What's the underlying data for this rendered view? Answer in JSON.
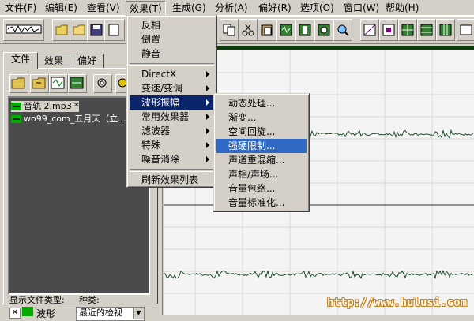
{
  "menubar": {
    "items": [
      {
        "label": "文件(F)"
      },
      {
        "label": "编辑(E)"
      },
      {
        "label": "查看(V)"
      },
      {
        "label": "效果(T)"
      },
      {
        "label": "生成(G)"
      },
      {
        "label": "分析(A)"
      },
      {
        "label": "偏好(R)"
      },
      {
        "label": "选项(O)"
      },
      {
        "label": "窗口(W)"
      },
      {
        "label": "帮助(H)"
      }
    ]
  },
  "left_panel": {
    "tabs": [
      {
        "label": "文件"
      },
      {
        "label": "效果"
      },
      {
        "label": "偏好"
      }
    ],
    "files": [
      {
        "name": "音轨  2.mp3 *"
      },
      {
        "name": "wo99_com_五月天（立..."
      }
    ],
    "file_type_label": "显示文件类型:",
    "kind_label": "种类:",
    "checkbox_label": "波形",
    "sort_value": "最近的检视"
  },
  "effects_menu": {
    "items": [
      {
        "label": "反相"
      },
      {
        "label": "倒置"
      },
      {
        "label": "静音"
      },
      {
        "label": "DirectX"
      },
      {
        "label": "变速/变调"
      },
      {
        "label": "波形振幅"
      },
      {
        "label": "常用效果器"
      },
      {
        "label": "滤波器"
      },
      {
        "label": "特殊"
      },
      {
        "label": "噪音消除"
      },
      {
        "label": "刷新效果列表"
      }
    ]
  },
  "amplitude_submenu": {
    "items": [
      {
        "label": "动态处理..."
      },
      {
        "label": "渐变..."
      },
      {
        "label": "空间回旋..."
      },
      {
        "label": "强硬限制..."
      },
      {
        "label": "声道重混缩..."
      },
      {
        "label": "声相/声场..."
      },
      {
        "label": "音量包络..."
      },
      {
        "label": "音量标准化..."
      }
    ]
  },
  "watermark": "http://www.hulusi.com",
  "colors": {
    "chrome": "#d4d0c8",
    "highlight": "#0a246a",
    "submenu_highlight": "#3169c6",
    "wave": "#1e4d2b",
    "file_list_bg": "#4b4b4b"
  }
}
